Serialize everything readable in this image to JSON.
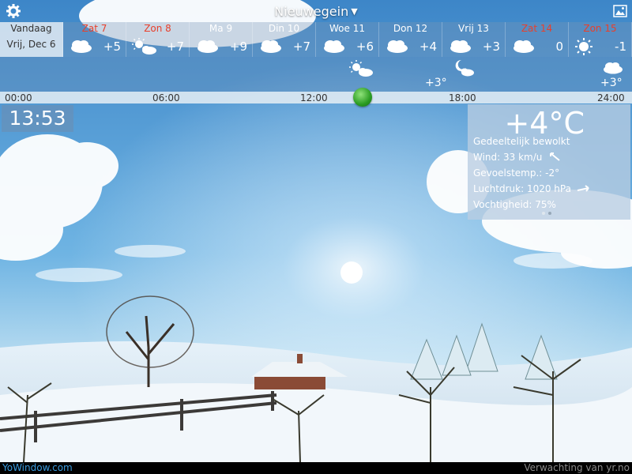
{
  "header": {
    "city": "Nieuwegein",
    "caret": "▼"
  },
  "today": {
    "name": "Vandaag",
    "date": "Vrij, Dec 6"
  },
  "days": [
    {
      "name": "Zat 7",
      "temp": "+5",
      "icon": "cloud-icon",
      "weekend": true
    },
    {
      "name": "Zon 8",
      "temp": "+7",
      "icon": "sun-cloud-icon",
      "weekend": true
    },
    {
      "name": "Ma 9",
      "temp": "+9",
      "icon": "cloud-icon",
      "weekend": false
    },
    {
      "name": "Din 10",
      "temp": "+7",
      "icon": "cloud-icon",
      "weekend": false
    },
    {
      "name": "Woe 11",
      "temp": "+6",
      "icon": "cloud-icon",
      "weekend": false
    },
    {
      "name": "Don 12",
      "temp": "+4",
      "icon": "cloud-icon",
      "weekend": false
    },
    {
      "name": "Vrij 13",
      "temp": "+3",
      "icon": "cloud-icon",
      "weekend": false
    },
    {
      "name": "Zat 14",
      "temp": "0",
      "icon": "cloud-icon",
      "weekend": true
    },
    {
      "name": "Zon 15",
      "temp": "-1",
      "icon": "sun-icon",
      "weekend": true
    }
  ],
  "hourly": {
    "temp_evening": "+3°",
    "temp_night": "+3°"
  },
  "timeline": [
    "00:00",
    "06:00",
    "12:00",
    "18:00",
    "24:00"
  ],
  "clock": "13:53",
  "current": {
    "temperature": "+4°C",
    "condition": "Gedeeltelijk bewolkt",
    "wind": "Wind:  33 km/u",
    "feels": "Gevoelstemp.: -2°",
    "pressure": "Luchtdruk: 1020 hPa",
    "humidity": "Vochtigheid:  75%"
  },
  "footer": {
    "brand": "YoWindow.com",
    "source": "Verwachting van yr.no"
  },
  "colors": {
    "weekend": "#e8402c",
    "brand": "#3a9bde",
    "knob": "#2a9c22"
  }
}
